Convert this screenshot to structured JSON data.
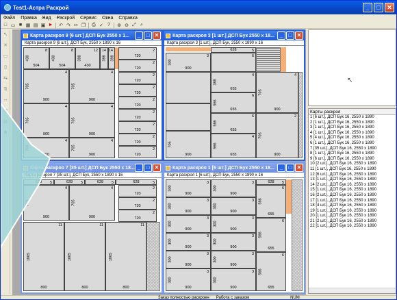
{
  "window": {
    "title": "Test1-Астра Раскрой"
  },
  "menu": [
    "Файл",
    "Правка",
    "Вид",
    "Раскрой",
    "Сервис",
    "Окна",
    "Справка"
  ],
  "toolbar_icons": [
    "new-icon",
    "open-icon",
    "save-icon",
    "grid-icon",
    "view-icon",
    "print-icon",
    "run-icon",
    "undo-icon",
    "redo-icon",
    "cut-icon",
    "copy-icon",
    "print2-icon",
    "check-icon",
    "help-icon",
    "zoom-in-icon",
    "zoom-out-icon",
    "zoom-fit-icon",
    "zoom-area-icon"
  ],
  "windows": [
    {
      "title": "Карта раскроя 9 [6 шт.] ДСП Бук 2550 x 1...",
      "subtitle": "Карта раскроя 9 [6 шт.], ДСП Бук, 2550 x 1890 x 16"
    },
    {
      "title": "Карта раскроя 3 [1 шт.] ДСП Бук 2550 x 18...",
      "subtitle": "Карта раскроя 3 [1 шт.], ДСП Бук, 2550 x 1890 x 16"
    },
    {
      "title": "Карта раскроя 7 [35 шт.] ДСП Бук 2550 x 18...",
      "subtitle": "Карта раскроя 7 [35 шт.], ДСП Бук, 2550 x 1890 x 16"
    },
    {
      "title": "Карта раскроя 1 [6 шт.] ДСП Бук 2550 x 18...",
      "subtitle": "Карта раскроя 1 [6 шт.], ДСП Бук, 2550 x 1890 x 16"
    }
  ],
  "list": {
    "header": "Карты раскроя",
    "items": [
      "1 [6 шт.], ДСП Бук 16, 2550 x 1890",
      "2 [1 шт.], ДСП Бук 16, 2550 x 1890",
      "3 [1 шт.], ДСП Бук 16, 2550 x 1890",
      "4 [1 шт.], ДСП Бук 16, 2550 x 1890",
      "5 [4 шт.], ДСП Бук 16, 2550 x 1890",
      "6 [1 шт.], ДСП Бук 16, 2550 x 1890",
      "7 [35 шт.], ДСП Бук 16, 2550 x 1890",
      "8 [1 шт.], ДСП Бук 16, 2550 x 1890",
      "9 [6 шт.], ДСП Бук 16, 2550 x 1890",
      "10 [2 шт.], ДСП Бук 16, 2550 x 1890",
      "11 [1 шт.], ДСП Бук 16, 2550 x 1890",
      "12 [6 шт.], ДСП Бук 16, 2550 x 1890",
      "13 [1 шт.], ДСП Бук 16, 2550 x 1890",
      "14 [2 шт.], ДСП Бук 16, 2550 x 1890",
      "15 [1 шт.], ДСП Бук 16, 2550 x 1890",
      "16 [2 шт.], ДСП Бук 16, 2550 x 1890",
      "17 [1 шт.], ДСП Бук 16, 2550 x 1890",
      "18 [4 шт.], ДСП Бук 16, 2550 x 1890",
      "19 [1 шт.], ДСП Бук 16, 2550 x 1890",
      "20 [1 шт.], ДСП Бук 16, 2550 x 1890",
      "21 [2 шт.], ДСП Бук 16, 2550 x 1890",
      "22 [1 шт.], ДСП Бук 16, 2550 x 1890"
    ]
  },
  "status": {
    "left": "Заказ полностью раскроен",
    "middle": "Работа с заказом",
    "right": "NUM"
  },
  "colors": {
    "edge": "#f4b078",
    "part": "#dadada",
    "title_active": "#2059d9",
    "overlay": "#9fd6d8"
  }
}
